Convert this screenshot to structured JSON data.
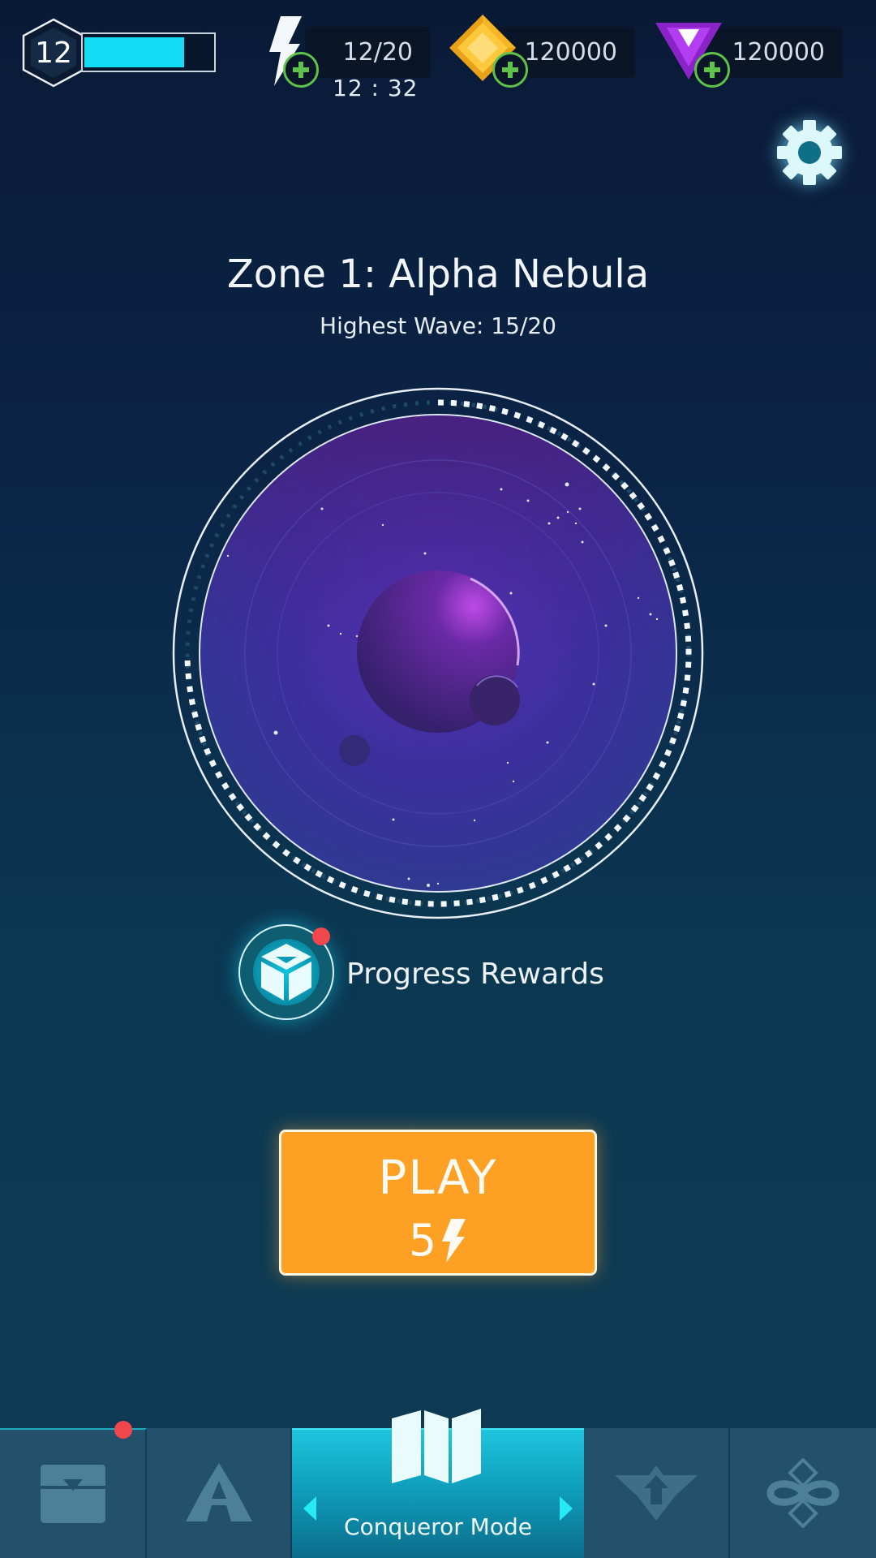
{
  "hud": {
    "player_level": "12",
    "xp_progress": 0.78,
    "energy": {
      "value": "12/20",
      "timer": "12 : 32",
      "icon": "lightning-icon"
    },
    "gold": {
      "value": "120000",
      "icon": "gold-gem-icon"
    },
    "gems": {
      "value": "120000",
      "icon": "purple-gem-icon"
    },
    "settings_icon": "gear-icon"
  },
  "zone": {
    "title": "Zone 1: Alpha Nebula",
    "subtitle": "Highest Wave: 15/20",
    "wave_progress": 0.75
  },
  "rewards": {
    "label": "Progress Rewards",
    "has_notification": true
  },
  "play": {
    "label": "PLAY",
    "cost": "5"
  },
  "nav": {
    "items": [
      {
        "name": "inventory",
        "icon": "chest-icon",
        "has_notification": true
      },
      {
        "name": "ships",
        "icon": "ship-icon"
      },
      {
        "name": "conqueror",
        "icon": "map-icon",
        "label": "Conqueror Mode",
        "active": true
      },
      {
        "name": "upgrades",
        "icon": "wings-icon"
      },
      {
        "name": "endless",
        "icon": "infinity-icon"
      }
    ]
  },
  "colors": {
    "accent": "#13dcf5",
    "play": "#fda024",
    "plus": "#5fc24a",
    "notification": "#f2464d"
  }
}
